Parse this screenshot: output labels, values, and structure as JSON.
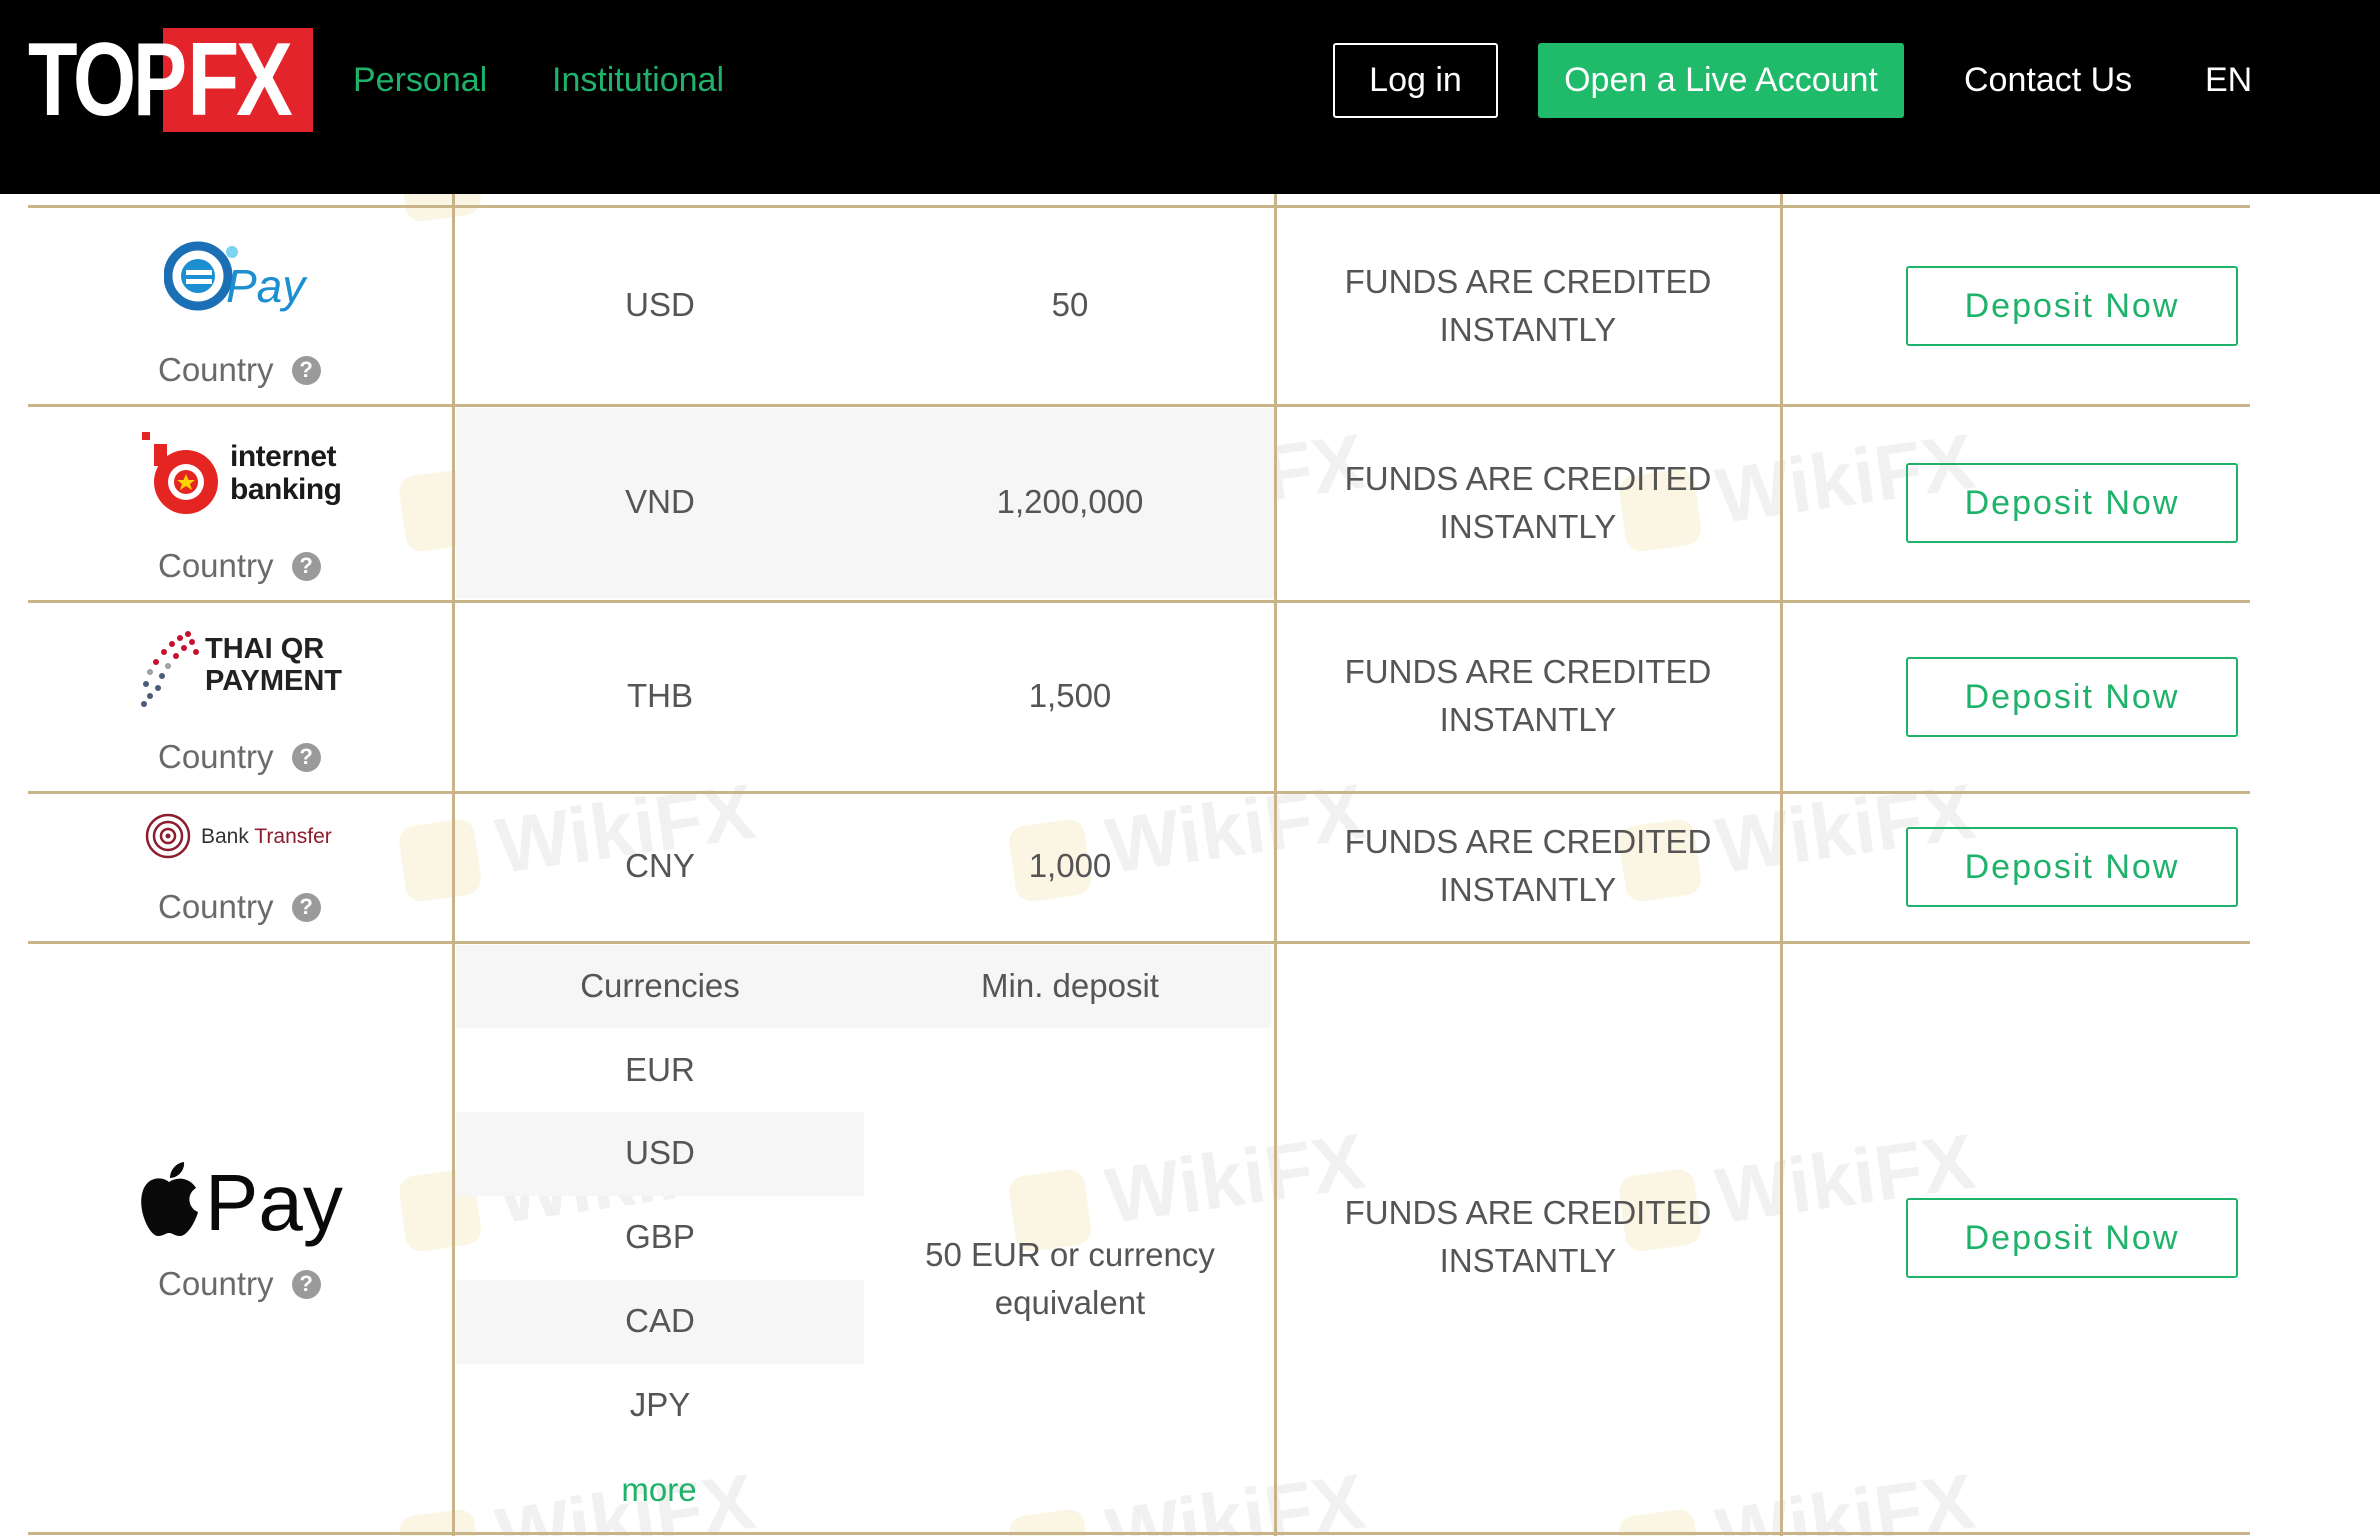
{
  "header": {
    "logo_top": "TOP",
    "logo_fx": "FX",
    "nav": [
      "Personal",
      "Institutional"
    ],
    "login": "Log in",
    "open_live": "Open a Live Account",
    "contact": "Contact Us",
    "language": "EN"
  },
  "colors": {
    "accent_green": "#1fb26a",
    "grid_line": "#c9b48a",
    "header_bg": "#000000",
    "logo_red": "#e3242b"
  },
  "watermark": "WikiFX",
  "rows": [
    {
      "method": "ePay",
      "logo_text": "Pay",
      "country_label": "Country",
      "currency": "USD",
      "min_deposit": "50",
      "processing": [
        "FUNDS ARE CREDITED",
        "INSTANTLY"
      ],
      "button": "Deposit Now"
    },
    {
      "method": "internet banking",
      "logo_text": [
        "internet",
        "banking"
      ],
      "country_label": "Country",
      "currency": "VND",
      "min_deposit": "1,200,000",
      "processing": [
        "FUNDS ARE CREDITED",
        "INSTANTLY"
      ],
      "button": "Deposit Now"
    },
    {
      "method": "Thai QR Payment",
      "logo_text": [
        "THAI QR",
        "PAYMENT"
      ],
      "country_label": "Country",
      "currency": "THB",
      "min_deposit": "1,500",
      "processing": [
        "FUNDS ARE CREDITED",
        "INSTANTLY"
      ],
      "button": "Deposit Now"
    },
    {
      "method": "Bank Transfer",
      "logo_text": [
        "Bank",
        "Transfer"
      ],
      "country_label": "Country",
      "currency": "CNY",
      "min_deposit": "1,000",
      "processing": [
        "FUNDS ARE CREDITED",
        "INSTANTLY"
      ],
      "button": "Deposit Now"
    },
    {
      "method": "Apple Pay",
      "logo_text": "Pay",
      "country_label": "Country",
      "sub_headers": [
        "Currencies",
        "Min. deposit"
      ],
      "currencies": [
        "EUR",
        "USD",
        "GBP",
        "CAD",
        "JPY"
      ],
      "more": "more",
      "min_deposit": [
        "50 EUR or currency",
        "equivalent"
      ],
      "processing": [
        "FUNDS ARE CREDITED",
        "INSTANTLY"
      ],
      "button": "Deposit Now"
    }
  ]
}
